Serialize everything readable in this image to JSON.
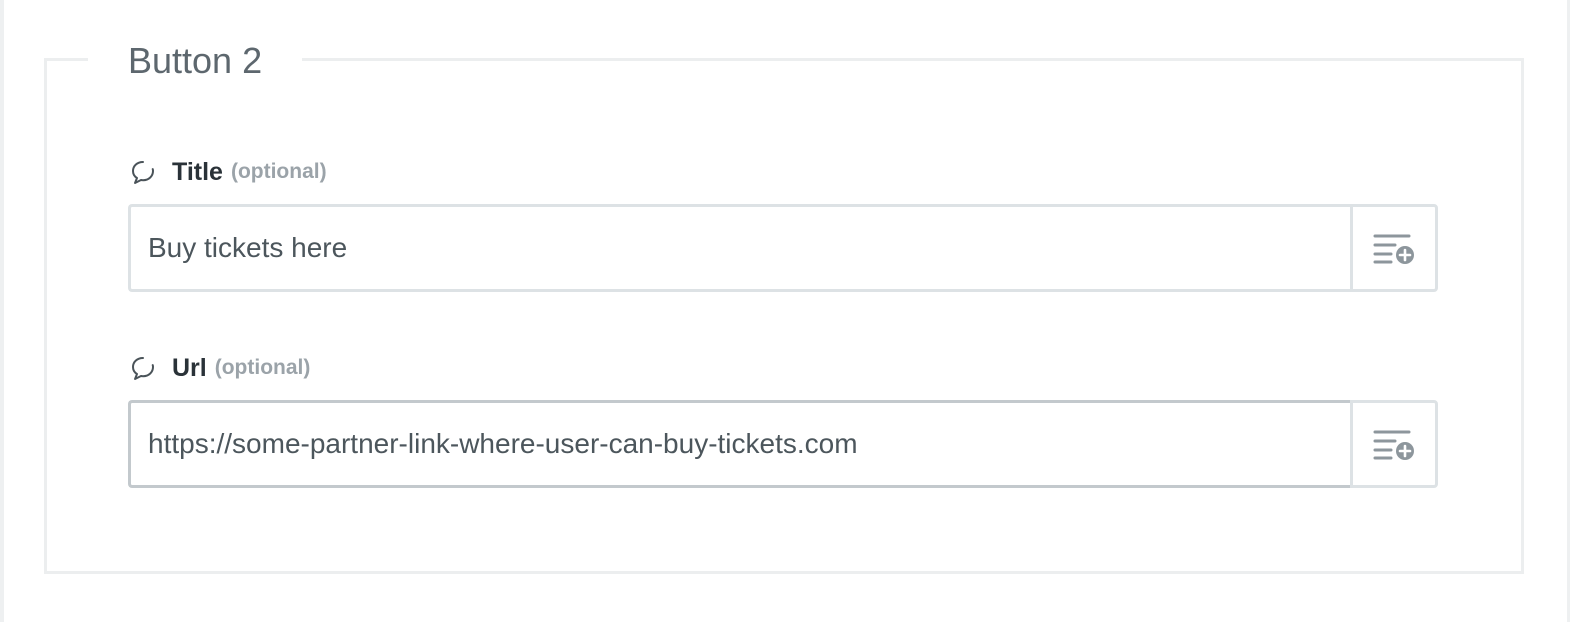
{
  "section": {
    "legend": "Button 2"
  },
  "fields": [
    {
      "label": "Title",
      "optional": "(optional)",
      "value": "Buy tickets here",
      "icon": "speech-bubble-icon",
      "addon_icon": "add-variable-icon"
    },
    {
      "label": "Url",
      "optional": "(optional)",
      "value": "https://some-partner-link-where-user-can-buy-tickets.com",
      "icon": "speech-bubble-icon",
      "addon_icon": "add-variable-icon"
    }
  ],
  "colors": {
    "border": "#dde2e5",
    "label": "#2a3238",
    "muted": "#9ba3a9",
    "legend": "#5d676e",
    "icon": "#8d969c"
  }
}
